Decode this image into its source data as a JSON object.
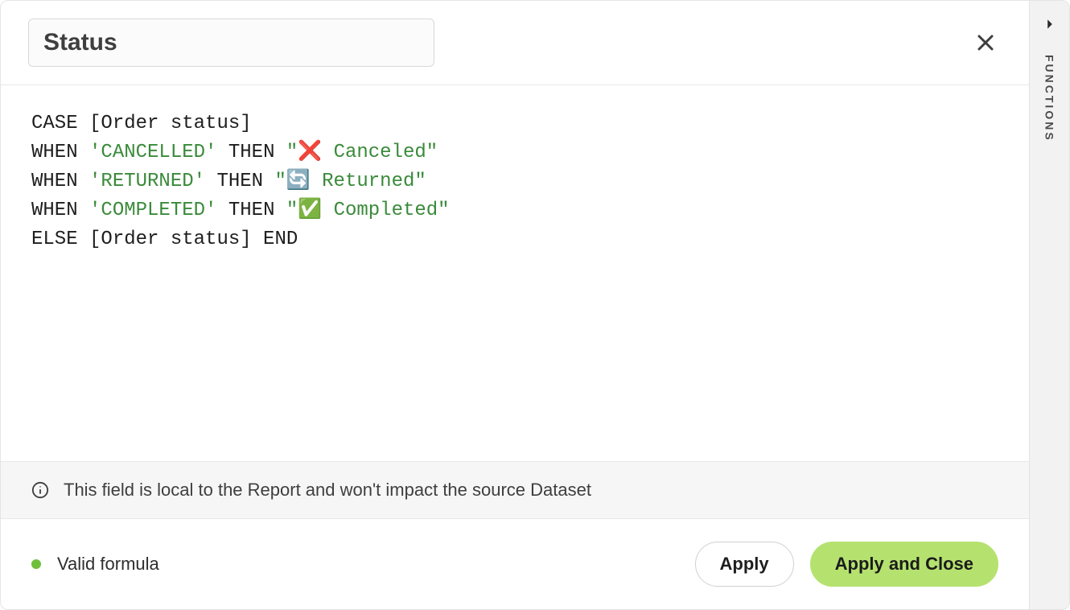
{
  "header": {
    "name_value": "Status"
  },
  "code": {
    "line1_kw1": "CASE",
    "line1_field": " [Order status]",
    "line2_kw1": "WHEN ",
    "line2_str1": "'CANCELLED'",
    "line2_kw2": " THEN ",
    "line2_str2": "\"❌ Canceled\"",
    "line3_kw1": "WHEN ",
    "line3_str1": "'RETURNED'",
    "line3_kw2": " THEN ",
    "line3_str2": "\"🔄 Returned\"",
    "line4_kw1": "WHEN ",
    "line4_str1": "'COMPLETED'",
    "line4_kw2": " THEN ",
    "line4_str2": "\"✅ Completed\"",
    "line5_kw1": "ELSE",
    "line5_field": " [Order status] ",
    "line5_kw2": "END"
  },
  "info_bar": {
    "text": "This field is local to the Report and won't impact the source Dataset"
  },
  "footer": {
    "status_text": "Valid formula",
    "apply_label": "Apply",
    "apply_close_label": "Apply and Close"
  },
  "side_rail": {
    "label": "FUNCTIONS"
  }
}
